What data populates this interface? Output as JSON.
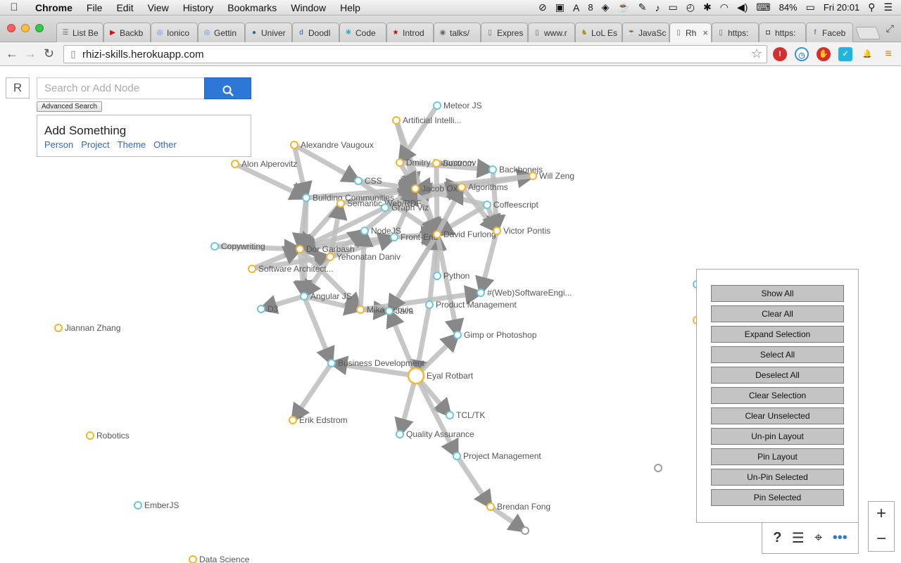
{
  "menubar": {
    "app_name": "Chrome",
    "items": [
      "File",
      "Edit",
      "View",
      "History",
      "Bookmarks",
      "Window",
      "Help"
    ],
    "battery": "84%",
    "clock": "Fri 20:01",
    "adobe_count": "8"
  },
  "tabs": [
    {
      "title": "List Be",
      "icon": "list-icon"
    },
    {
      "title": "Backb",
      "icon": "youtube-icon"
    },
    {
      "title": "Ionico",
      "icon": "ionic-icon"
    },
    {
      "title": "Gettin",
      "icon": "ionic-icon"
    },
    {
      "title": "Univer",
      "icon": "univ-icon"
    },
    {
      "title": "Doodl",
      "icon": "doodle-icon"
    },
    {
      "title": "Code",
      "icon": "code-icon"
    },
    {
      "title": "Introd",
      "icon": "star-icon"
    },
    {
      "title": "talks/",
      "icon": "github-icon"
    },
    {
      "title": "Expres",
      "icon": "page-icon"
    },
    {
      "title": "www.r",
      "icon": "page-icon"
    },
    {
      "title": "LoL Es",
      "icon": "lol-icon"
    },
    {
      "title": "JavaSc",
      "icon": "js-icon"
    },
    {
      "title": "Rh",
      "icon": "page-icon",
      "active": true
    },
    {
      "title": "https:",
      "icon": "page-icon"
    },
    {
      "title": "https:",
      "icon": "lock-icon"
    },
    {
      "title": "Faceb",
      "icon": "facebook-icon"
    }
  ],
  "address": {
    "url": "rhizi-skills.herokuapp.com"
  },
  "app": {
    "logo": "R",
    "search": {
      "placeholder": "Search or Add Node"
    },
    "advanced_search_label": "Advanced Search",
    "add_panel": {
      "title": "Add Something",
      "links": [
        "Person",
        "Project",
        "Theme",
        "Other"
      ]
    },
    "filter_buttons": [
      "Show All",
      "Clear All",
      "Expand Selection",
      "Select All",
      "Deselect All",
      "Clear Selection",
      "Clear Unselected",
      "Un-pin Layout",
      "Pin Layout",
      "Un-Pin Selected",
      "Pin Selected"
    ],
    "zoom": {
      "in": "+",
      "out": "−"
    },
    "colors": {
      "person": "#f3b72b",
      "skill": "#6cc8d8",
      "edge": "#bdbdbd",
      "other": "#9e9e9e"
    }
  },
  "graph": {
    "nodes": [
      {
        "id": "meteor",
        "label": "Meteor JS",
        "type": "skill"
      },
      {
        "id": "ai",
        "label": "Artificial Intelli...",
        "type": "person"
      },
      {
        "id": "vaugoux",
        "label": "Alexandre Vaugoux",
        "type": "person"
      },
      {
        "id": "alperovitz",
        "label": "Alon Alperovitz",
        "type": "person"
      },
      {
        "id": "dmitry",
        "label": "Dmitry Paramonov",
        "type": "person"
      },
      {
        "id": "bostrom",
        "label": "Bostrom",
        "type": "person"
      },
      {
        "id": "backbone",
        "label": "Backbonejs",
        "type": "skill"
      },
      {
        "id": "willzeng",
        "label": "Will Zeng",
        "type": "person"
      },
      {
        "id": "css",
        "label": "CSS",
        "type": "skill"
      },
      {
        "id": "jacob",
        "label": "Jacob Ox",
        "type": "person"
      },
      {
        "id": "algorithms",
        "label": "Algorithms",
        "type": "person"
      },
      {
        "id": "building",
        "label": "Building Communities",
        "type": "skill"
      },
      {
        "id": "semweb",
        "label": "Semantic Web/RDF",
        "type": "person"
      },
      {
        "id": "graphviz",
        "label": "Graph Viz",
        "type": "skill"
      },
      {
        "id": "coffee",
        "label": "Coffeescript",
        "type": "skill"
      },
      {
        "id": "nodejs",
        "label": "NodeJS",
        "type": "skill"
      },
      {
        "id": "frontend",
        "label": "Front-End",
        "type": "skill"
      },
      {
        "id": "furlong",
        "label": "David Furlong",
        "type": "person"
      },
      {
        "id": "pontis",
        "label": "Victor Pontis",
        "type": "person"
      },
      {
        "id": "copywriting",
        "label": "Copywriting",
        "type": "skill"
      },
      {
        "id": "garbash",
        "label": "Dor Garbash",
        "type": "person"
      },
      {
        "id": "yehonatan",
        "label": "Yehonatan Daniv",
        "type": "person"
      },
      {
        "id": "softarch",
        "label": "Software Architect...",
        "type": "person"
      },
      {
        "id": "python",
        "label": "Python",
        "type": "skill"
      },
      {
        "id": "websoft",
        "label": "#(Web)SoftwareEngi...",
        "type": "skill"
      },
      {
        "id": "angular",
        "label": "Angular JS",
        "type": "skill"
      },
      {
        "id": "d3",
        "label": "D3",
        "type": "skill"
      },
      {
        "id": "mika",
        "label": "Mika Ceovic",
        "type": "person"
      },
      {
        "id": "java",
        "label": "Java",
        "type": "skill"
      },
      {
        "id": "prodmgmt",
        "label": "Product Management",
        "type": "skill"
      },
      {
        "id": "jiannan",
        "label": "Jiannan Zhang",
        "type": "person"
      },
      {
        "id": "gimp",
        "label": "Gimp or Photoshop",
        "type": "skill"
      },
      {
        "id": "bizdev",
        "label": "Business Development",
        "type": "skill"
      },
      {
        "id": "eyal",
        "label": "Eyal Rotbart",
        "type": "person",
        "big": true
      },
      {
        "id": "tcl",
        "label": "TCL/TK",
        "type": "skill"
      },
      {
        "id": "edstrom",
        "label": "Erik Edstrom",
        "type": "person"
      },
      {
        "id": "qa",
        "label": "Quality Assurance",
        "type": "skill"
      },
      {
        "id": "robotics",
        "label": "Robotics",
        "type": "person"
      },
      {
        "id": "projmgmt",
        "label": "Project Management",
        "type": "skill"
      },
      {
        "id": "brendan",
        "label": "Brendan Fong",
        "type": "person"
      },
      {
        "id": "ember",
        "label": "EmberJS",
        "type": "skill"
      },
      {
        "id": "datasci",
        "label": "Data Science",
        "type": "person"
      },
      {
        "id": "g1",
        "label": "",
        "type": "other"
      },
      {
        "id": "g2",
        "label": "",
        "type": "other"
      },
      {
        "id": "off1",
        "label": "",
        "type": "skill"
      },
      {
        "id": "off2",
        "label": "",
        "type": "person"
      }
    ],
    "edges": [
      [
        "vaugoux",
        "building"
      ],
      [
        "vaugoux",
        "css"
      ],
      [
        "alperovitz",
        "building"
      ],
      [
        "building",
        "jacob"
      ],
      [
        "building",
        "angular"
      ],
      [
        "building",
        "garbash"
      ],
      [
        "css",
        "jacob"
      ],
      [
        "css",
        "furlong"
      ],
      [
        "ai",
        "jacob"
      ],
      [
        "ai",
        "furlong"
      ],
      [
        "meteor",
        "dmitry"
      ],
      [
        "dmitry",
        "jacob"
      ],
      [
        "dmitry",
        "backbone"
      ],
      [
        "bostrom",
        "furlong"
      ],
      [
        "jacob",
        "algorithms"
      ],
      [
        "jacob",
        "furlong"
      ],
      [
        "algorithms",
        "willzeng"
      ],
      [
        "willzeng",
        "jacob"
      ],
      [
        "algorithms",
        "pontis"
      ],
      [
        "backbone",
        "pontis"
      ],
      [
        "coffee",
        "jacob"
      ],
      [
        "coffee",
        "furlong"
      ],
      [
        "coffee",
        "pontis"
      ],
      [
        "semweb",
        "garbash"
      ],
      [
        "semweb",
        "jacob"
      ],
      [
        "graphviz",
        "garbash"
      ],
      [
        "graphviz",
        "jacob"
      ],
      [
        "graphviz",
        "algorithms"
      ],
      [
        "nodejs",
        "garbash"
      ],
      [
        "nodejs",
        "jacob"
      ],
      [
        "frontend",
        "furlong"
      ],
      [
        "frontend",
        "garbash"
      ],
      [
        "frontend",
        "jacob"
      ],
      [
        "copywriting",
        "garbash"
      ],
      [
        "softarch",
        "yehonatan"
      ],
      [
        "softarch",
        "garbash"
      ],
      [
        "yehonatan",
        "angular"
      ],
      [
        "yehonatan",
        "frontend"
      ],
      [
        "yehonatan",
        "nodejs"
      ],
      [
        "yehonatan",
        "semweb"
      ],
      [
        "garbash",
        "angular"
      ],
      [
        "garbash",
        "mika"
      ],
      [
        "angular",
        "mika"
      ],
      [
        "angular",
        "d3"
      ],
      [
        "angular",
        "bizdev"
      ],
      [
        "mika",
        "java"
      ],
      [
        "mika",
        "websoft"
      ],
      [
        "mika",
        "nodejs"
      ],
      [
        "java",
        "furlong"
      ],
      [
        "python",
        "furlong"
      ],
      [
        "prodmgmt",
        "furlong"
      ],
      [
        "prodmgmt",
        "eyal"
      ],
      [
        "pontis",
        "websoft"
      ],
      [
        "furlong",
        "java"
      ],
      [
        "furlong",
        "gimp"
      ],
      [
        "furlong",
        "algorithms"
      ],
      [
        "eyal",
        "bizdev"
      ],
      [
        "eyal",
        "gimp"
      ],
      [
        "eyal",
        "tcl"
      ],
      [
        "eyal",
        "qa"
      ],
      [
        "eyal",
        "projmgmt"
      ],
      [
        "eyal",
        "java"
      ],
      [
        "bizdev",
        "edstrom"
      ],
      [
        "projmgmt",
        "brendan"
      ],
      [
        "brendan",
        "g1"
      ]
    ]
  }
}
